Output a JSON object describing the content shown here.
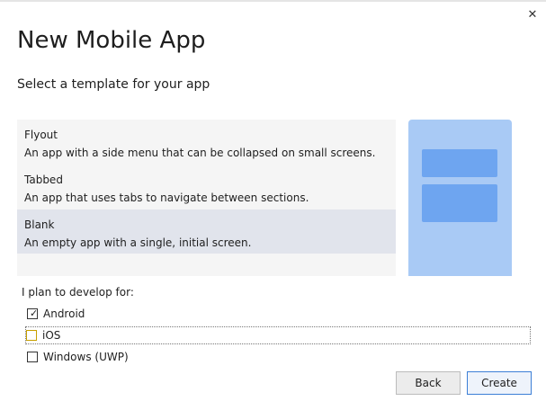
{
  "window": {
    "close_icon": "close-icon"
  },
  "header": {
    "title": "New Mobile App",
    "subtitle": "Select a template for your app"
  },
  "templates": [
    {
      "name": "Flyout",
      "description": "An app with a side menu that can be collapsed on small screens.",
      "selected": false
    },
    {
      "name": "Tabbed",
      "description": "An app that uses tabs to navigate between sections.",
      "selected": false
    },
    {
      "name": "Blank",
      "description": "An empty app with a single, initial screen.",
      "selected": true
    }
  ],
  "platforms": {
    "label": "I plan to develop for:",
    "options": [
      {
        "label": "Android",
        "checked": true
      },
      {
        "label": "iOS",
        "checked": false
      },
      {
        "label": "Windows (UWP)",
        "checked": false
      }
    ]
  },
  "buttons": {
    "back": "Back",
    "create": "Create"
  },
  "colors": {
    "preview_bg": "#a9caf5",
    "preview_block": "#6ea5f0",
    "selected_item": "#e1e4ec",
    "primary_border": "#3c7fd6"
  }
}
